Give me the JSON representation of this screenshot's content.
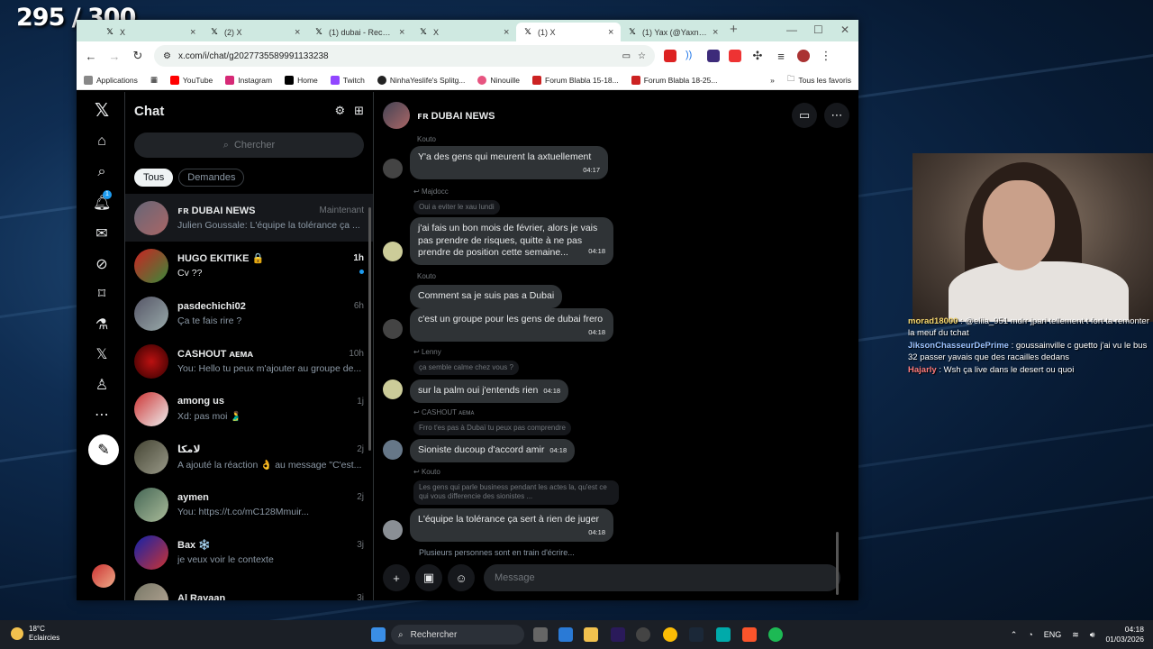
{
  "overlay": {
    "counter": "295 / 300"
  },
  "browser": {
    "tabs": [
      {
        "title": "X",
        "active": false
      },
      {
        "title": "(2) X",
        "active": false
      },
      {
        "title": "(1) dubai - Recherche",
        "active": false
      },
      {
        "title": "X",
        "active": false
      },
      {
        "title": "(1) X",
        "active": true
      },
      {
        "title": "(1) Yax (@Yaxnag)",
        "active": false
      }
    ],
    "new_tab": "+",
    "url": "x.com/i/chat/g2027735589991133238",
    "bookmarks": [
      "Applications",
      "YouTube",
      "Instagram",
      "Home",
      "Twitch",
      "NinhaYeslife's Splitg...",
      "Ninouille",
      "Forum Blabla 15-18...",
      "Forum Blabla 18-25..."
    ],
    "bookmarks_more": "»",
    "all_bookmarks": "Tous les favoris"
  },
  "nav": {
    "notif_badge": "1"
  },
  "list": {
    "title": "Chat",
    "search_placeholder": "Chercher",
    "filters": [
      "Tous",
      "Demandes"
    ],
    "conversations": [
      {
        "name": "ꜰʀ DUBAI NEWS",
        "time": "Maintenant",
        "preview": "Julien Goussale: L'équipe la tolérance ça ...",
        "color": "#5a6b7e"
      },
      {
        "name": "HUGO EKITIKE 🔒",
        "time": "1h",
        "preview": "Cv ??",
        "color": "#3a8a3a",
        "unread": true
      },
      {
        "name": "pasdechichi02",
        "time": "6h",
        "preview": "Ça te fais rire ?",
        "color": "#6b7280"
      },
      {
        "name": "CASHOUT ᴀᴇᴍᴀ",
        "time": "10h",
        "preview": "You: Hello tu peux m'ajouter au groupe de...",
        "color": "#7a1010"
      },
      {
        "name": "among us",
        "time": "1j",
        "preview": "Xd: pas moi 🫃",
        "color": "#d0d0d0"
      },
      {
        "name": "لامكا",
        "time": "2j",
        "preview": "A ajouté la réaction 👌 au message \"C'est...",
        "color": "#7a6a5a"
      },
      {
        "name": "aymen",
        "time": "2j",
        "preview": "You: https://t.co/mC128Mmuir...",
        "color": "#5a6a4a"
      },
      {
        "name": "Bax ❄️",
        "time": "3j",
        "preview": "je veux voir le contexte",
        "color": "#2a3a8a"
      },
      {
        "name": "Al Rayaan",
        "time": "3j",
        "preview": "",
        "color": "#887766"
      }
    ]
  },
  "chat": {
    "title": "ꜰʀ DUBAI NEWS",
    "typing": "Plusieurs personnes sont en train d'écrire...",
    "input_placeholder": "Message",
    "messages": [
      {
        "sender": "Kouto",
        "text": "Y'a des gens qui meurent la axtuellement",
        "time": "04:17"
      },
      {
        "reply_to": "Majdocc",
        "quote": "Oui a eviter le xau lundi",
        "text": "j'ai fais un bon mois de février, alors je vais pas prendre de risques, quitte à ne pas prendre de position cette semaine...",
        "time": "04:18"
      },
      {
        "sender": "Kouto",
        "text": "Comment sa je suis pas a Dubai",
        "time": ""
      },
      {
        "text": "c'est un groupe pour les gens de dubai frero",
        "time": "04:18"
      },
      {
        "reply_to": "Lenny",
        "quote": "ça semble calme chez vous ?",
        "text": "sur la palm oui j'entends rien",
        "time": "04:18"
      },
      {
        "reply_to": "CASHOUT ᴀᴇᴍᴀ",
        "quote": "Frro t'es pas à Dubaï tu peux pas comprendre",
        "text": "Sioniste ducoup d'accord amir",
        "time": "04:18"
      },
      {
        "reply_to": "Kouto",
        "quote": "Les gens qui parle business pendant les actes la, qu'est ce qui vous differencie des sionistes ...",
        "text": "L'équipe la tolérance ça sert à rien de juger",
        "time": "04:18"
      }
    ]
  },
  "stream_chat": [
    {
      "user": "morad18000",
      "text": "@eliia_951 mdrr jpari tellement t fort ta remonter la meuf du tchat",
      "color": "#f5d76e"
    },
    {
      "user": "JiksonChasseurDePrime",
      "text": "goussainville c guetto j'ai vu le bus 32 passer yavais que des racailles dedans",
      "color": "#9cc3ff"
    },
    {
      "user": "Hajarly",
      "text": "Wsh ça live dans le desert ou quoi",
      "color": "#ff7b7b"
    }
  ],
  "taskbar": {
    "temp": "18°C",
    "weather": "Eclaircies",
    "search": "Rechercher",
    "lang": "ENG",
    "time": "04:18",
    "date": "01/03/2026"
  }
}
